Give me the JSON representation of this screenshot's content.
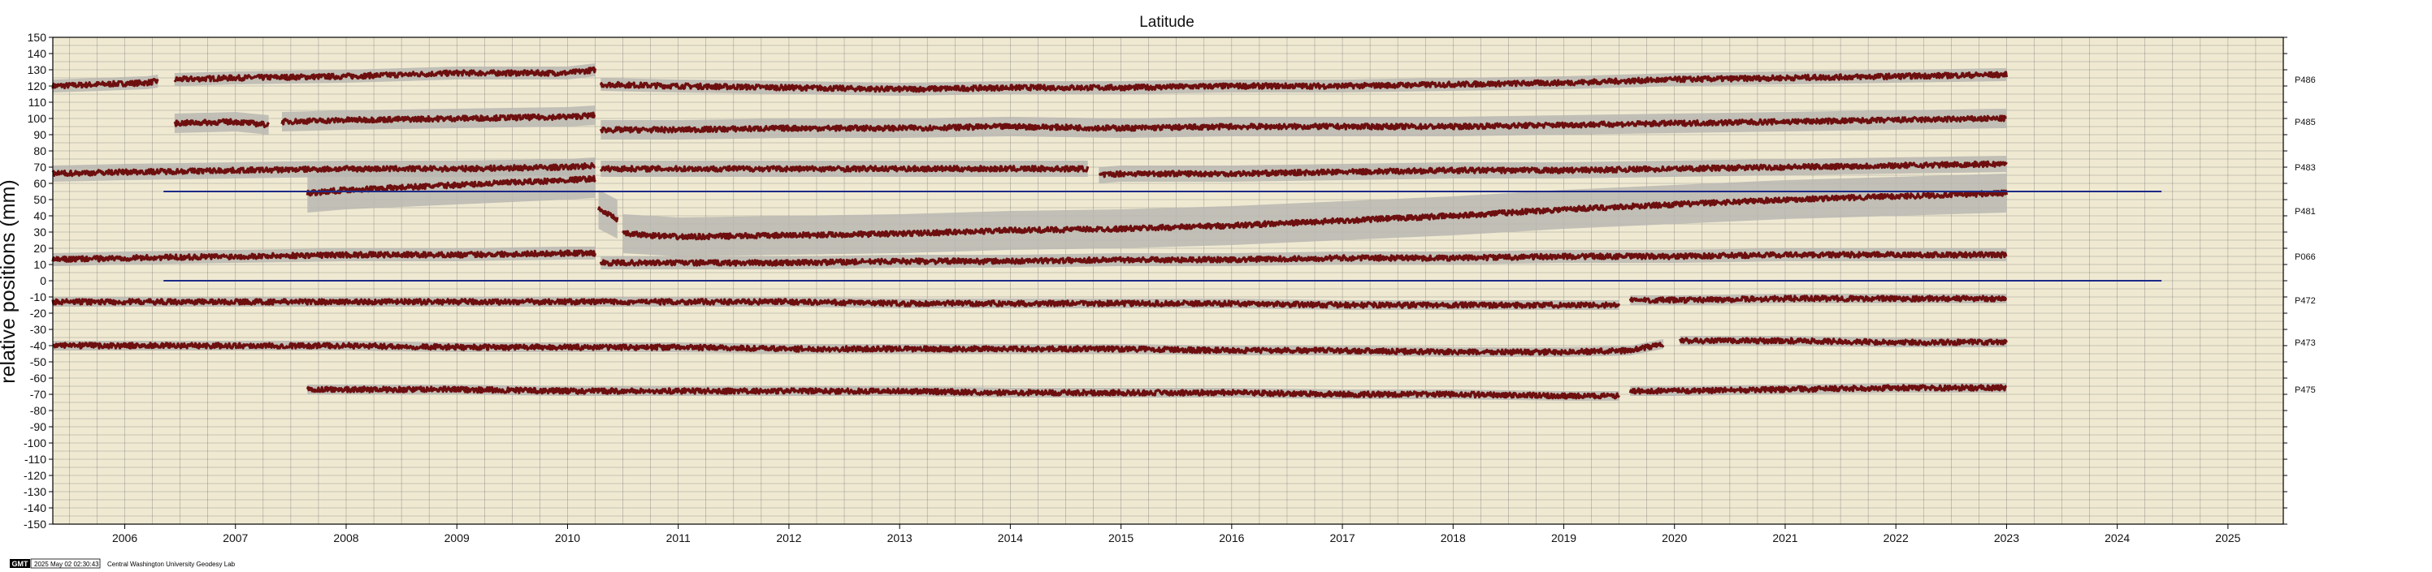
{
  "chart_data": {
    "type": "scatter",
    "title": "Latitude",
    "ylabel": "relative positions (mm)",
    "xlabel": "",
    "ylim": [
      -150,
      150
    ],
    "xlim": [
      2005.35,
      2025.5
    ],
    "y_ticks": [
      150,
      140,
      130,
      120,
      110,
      100,
      90,
      80,
      70,
      60,
      50,
      40,
      30,
      20,
      10,
      0,
      -10,
      -20,
      -30,
      -40,
      -50,
      -60,
      -70,
      -80,
      -90,
      -100,
      -110,
      -120,
      -130,
      -140,
      -150
    ],
    "x_ticks": [
      {
        "label": "2006",
        "x": 2006.0
      },
      {
        "label": "2007",
        "x": 2007.0
      },
      {
        "label": "2008",
        "x": 2008.0
      },
      {
        "label": "2009",
        "x": 2009.0
      },
      {
        "label": "2010",
        "x": 2010.0
      },
      {
        "label": "2011",
        "x": 2011.0
      },
      {
        "label": "2012",
        "x": 2012.0
      },
      {
        "label": "2013",
        "x": 2013.0
      },
      {
        "label": "2014",
        "x": 2014.0
      },
      {
        "label": "2015",
        "x": 2015.0
      },
      {
        "label": "2016",
        "x": 2016.0
      },
      {
        "label": "2017",
        "x": 2017.0
      },
      {
        "label": "2018",
        "x": 2018.0
      },
      {
        "label": "2019",
        "x": 2019.0
      },
      {
        "label": "2020",
        "x": 2020.0
      },
      {
        "label": "2021",
        "x": 2021.0
      },
      {
        "label": "2022",
        "x": 2022.0
      },
      {
        "label": "2023",
        "x": 2023.0
      },
      {
        "label": "2024",
        "x": 2024.0
      },
      {
        "label": "2025",
        "x": 2025.0
      }
    ],
    "grid": true,
    "grid_step_x": 0.25,
    "grid_step_y": 5,
    "series": [
      {
        "name": "P486",
        "label_y": 124,
        "segments": [
          {
            "points": [
              [
                2005.35,
                120
              ],
              [
                2006.2,
                122
              ],
              [
                2006.3,
                123
              ]
            ]
          },
          {
            "points": [
              [
                2006.45,
                124
              ],
              [
                2007,
                125
              ],
              [
                2008,
                126
              ],
              [
                2009,
                128
              ],
              [
                2010,
                128
              ],
              [
                2010.25,
                130
              ]
            ]
          },
          {
            "points": [
              [
                2010.3,
                121
              ],
              [
                2011,
                120
              ],
              [
                2012,
                119
              ],
              [
                2013,
                118
              ],
              [
                2014,
                119
              ],
              [
                2015,
                119
              ],
              [
                2016,
                120
              ],
              [
                2017,
                120
              ],
              [
                2018,
                121
              ],
              [
                2019,
                122
              ],
              [
                2020,
                124
              ],
              [
                2021,
                125
              ],
              [
                2022,
                126
              ],
              [
                2023,
                127
              ]
            ]
          }
        ],
        "band": 4
      },
      {
        "name": "P485",
        "label_y": 98,
        "segments": [
          {
            "points": [
              [
                2006.45,
                97
              ],
              [
                2007,
                98
              ],
              [
                2007.3,
                96
              ]
            ]
          },
          {
            "points": [
              [
                2007.42,
                98
              ],
              [
                2008,
                99
              ],
              [
                2009,
                100
              ],
              [
                2010,
                101
              ],
              [
                2010.25,
                102
              ]
            ]
          },
          {
            "points": [
              [
                2010.3,
                93
              ],
              [
                2011,
                93
              ],
              [
                2012,
                94
              ],
              [
                2013,
                94
              ],
              [
                2014,
                95
              ],
              [
                2015,
                94
              ],
              [
                2016,
                95
              ],
              [
                2017,
                95
              ],
              [
                2018,
                95
              ],
              [
                2019,
                96
              ],
              [
                2020,
                97
              ],
              [
                2021,
                98
              ],
              [
                2022,
                99
              ],
              [
                2023,
                100
              ]
            ]
          }
        ],
        "band": 6
      },
      {
        "name": "P483",
        "label_y": 70,
        "segments": [
          {
            "points": [
              [
                2005.35,
                66
              ],
              [
                2006,
                67
              ],
              [
                2007,
                68
              ],
              [
                2008,
                69
              ],
              [
                2009,
                69
              ],
              [
                2010,
                70
              ],
              [
                2010.25,
                71
              ]
            ]
          },
          {
            "points": [
              [
                2010.3,
                69
              ],
              [
                2011,
                69
              ],
              [
                2012,
                69
              ],
              [
                2013,
                69
              ],
              [
                2014,
                69
              ],
              [
                2014.7,
                69
              ]
            ]
          },
          {
            "points": [
              [
                2014.8,
                65
              ],
              [
                2015,
                66
              ],
              [
                2016,
                66
              ],
              [
                2017,
                67
              ],
              [
                2018,
                68
              ],
              [
                2019,
                68
              ],
              [
                2020,
                69
              ],
              [
                2021,
                70
              ],
              [
                2022,
                71
              ],
              [
                2023,
                72
              ]
            ]
          }
        ],
        "band": 5
      },
      {
        "name": "P481",
        "label_y": 43,
        "segments": [
          {
            "points": [
              [
                2007.65,
                54
              ],
              [
                2008,
                56
              ],
              [
                2009,
                59
              ],
              [
                2010,
                62
              ],
              [
                2010.25,
                63
              ]
            ]
          },
          {
            "points": [
              [
                2010.28,
                44
              ],
              [
                2010.45,
                38
              ]
            ]
          },
          {
            "points": [
              [
                2010.5,
                29
              ],
              [
                2011,
                27
              ],
              [
                2012,
                28
              ],
              [
                2013,
                29
              ],
              [
                2014,
                31
              ],
              [
                2015,
                32
              ],
              [
                2016,
                34
              ],
              [
                2017,
                37
              ],
              [
                2018,
                40
              ],
              [
                2019,
                44
              ],
              [
                2020,
                47
              ],
              [
                2021,
                50
              ],
              [
                2022,
                52
              ],
              [
                2023,
                54
              ]
            ]
          }
        ],
        "band": 12
      },
      {
        "name": "P066",
        "label_y": 15,
        "segments": [
          {
            "points": [
              [
                2005.35,
                13
              ],
              [
                2006,
                14
              ],
              [
                2007,
                15
              ],
              [
                2008,
                16
              ],
              [
                2009,
                16
              ],
              [
                2010,
                17
              ],
              [
                2010.25,
                17
              ]
            ]
          },
          {
            "points": [
              [
                2010.3,
                11
              ],
              [
                2011,
                11
              ],
              [
                2012,
                11
              ],
              [
                2013,
                12
              ],
              [
                2014,
                12
              ],
              [
                2015,
                13
              ],
              [
                2016,
                13
              ],
              [
                2017,
                14
              ],
              [
                2018,
                14
              ],
              [
                2019,
                15
              ],
              [
                2020,
                15
              ],
              [
                2021,
                16
              ],
              [
                2022,
                16
              ],
              [
                2023,
                16
              ]
            ]
          }
        ],
        "band": 4
      },
      {
        "name": "P472",
        "label_y": -12,
        "segments": [
          {
            "points": [
              [
                2005.35,
                -13
              ],
              [
                2006,
                -13
              ],
              [
                2007,
                -13
              ],
              [
                2008,
                -13
              ],
              [
                2009,
                -13
              ],
              [
                2010,
                -13
              ],
              [
                2011,
                -13
              ],
              [
                2012,
                -13
              ],
              [
                2013,
                -14
              ],
              [
                2014,
                -14
              ],
              [
                2015,
                -14
              ],
              [
                2016,
                -14
              ],
              [
                2017,
                -15
              ],
              [
                2018,
                -15
              ],
              [
                2019,
                -15
              ],
              [
                2019.5,
                -15
              ]
            ]
          },
          {
            "points": [
              [
                2019.6,
                -12
              ],
              [
                2020,
                -12
              ],
              [
                2021,
                -11
              ],
              [
                2022,
                -11
              ],
              [
                2023,
                -11
              ]
            ]
          }
        ],
        "band": 3
      },
      {
        "name": "P473",
        "label_y": -38,
        "segments": [
          {
            "points": [
              [
                2005.35,
                -40
              ],
              [
                2006,
                -40
              ],
              [
                2007,
                -40
              ],
              [
                2008,
                -40
              ],
              [
                2009,
                -41
              ],
              [
                2010,
                -41
              ],
              [
                2011,
                -41
              ],
              [
                2012,
                -42
              ],
              [
                2013,
                -42
              ],
              [
                2014,
                -42
              ],
              [
                2015,
                -42
              ],
              [
                2016,
                -43
              ],
              [
                2017,
                -43
              ],
              [
                2018,
                -44
              ],
              [
                2019,
                -44
              ],
              [
                2019.6,
                -43
              ],
              [
                2019.9,
                -39
              ]
            ]
          },
          {
            "points": [
              [
                2020.05,
                -37
              ],
              [
                2021,
                -37
              ],
              [
                2022,
                -38
              ],
              [
                2023,
                -38
              ]
            ]
          }
        ],
        "band": 3
      },
      {
        "name": "P475",
        "label_y": -67,
        "segments": [
          {
            "points": [
              [
                2007.65,
                -67
              ],
              [
                2008,
                -67
              ],
              [
                2009,
                -67
              ],
              [
                2010,
                -68
              ],
              [
                2011,
                -68
              ],
              [
                2012,
                -68
              ],
              [
                2013,
                -68
              ],
              [
                2014,
                -69
              ],
              [
                2015,
                -69
              ],
              [
                2016,
                -69
              ],
              [
                2017,
                -70
              ],
              [
                2018,
                -70
              ],
              [
                2019,
                -71
              ],
              [
                2019.5,
                -71
              ]
            ]
          },
          {
            "points": [
              [
                2019.6,
                -68
              ],
              [
                2020,
                -68
              ],
              [
                2021,
                -67
              ],
              [
                2022,
                -66
              ],
              [
                2023,
                -66
              ]
            ]
          }
        ],
        "band": 3
      }
    ],
    "reference_lines": [
      {
        "y": 55,
        "x_start": 2006.35,
        "x_end": 2024.4,
        "color": "#1c2a86"
      },
      {
        "y": 0,
        "x_start": 2006.35,
        "x_end": 2024.4,
        "color": "#1c2a86"
      }
    ]
  },
  "footer": {
    "logo": "GMT",
    "timestamp": "2025 May 02 02:30:43",
    "lab": "Central Washington University Geodesy Lab"
  }
}
